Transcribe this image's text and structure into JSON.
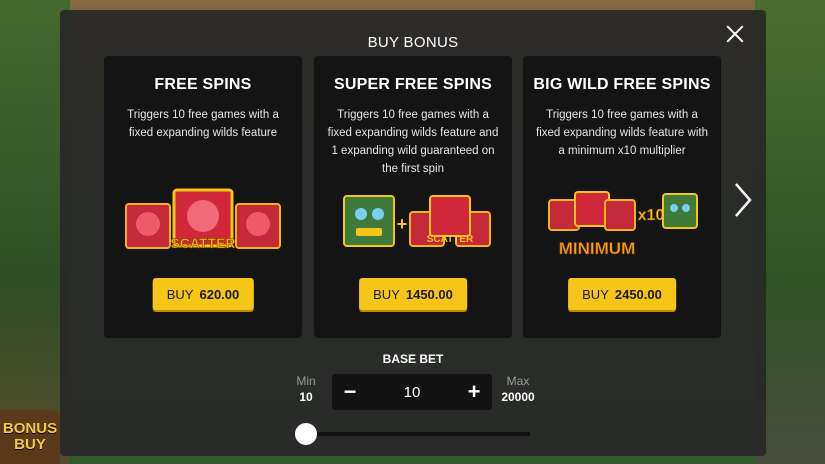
{
  "dialog": {
    "title": "BUY BONUS",
    "close_icon": "close-icon",
    "next_icon": "chevron-right-icon"
  },
  "background": {
    "badge_line1": "BONUS",
    "badge_line2": "BUY"
  },
  "cards": [
    {
      "title": "FREE SPINS",
      "description": "Triggers 10 free games with a fixed expanding wilds feature",
      "buy_label": "BUY",
      "price": "620.00",
      "art_text": "SCATTER"
    },
    {
      "title": "SUPER FREE SPINS",
      "description": "Triggers 10 free games with a fixed expanding wilds feature and 1 expanding wild guaranteed on the first spin",
      "buy_label": "BUY",
      "price": "1450.00",
      "art_text": "SCATTER"
    },
    {
      "title": "BIG WILD FREE SPINS",
      "description": "Triggers 10 free games with a fixed expanding wilds feature with a minimum x10 multiplier",
      "buy_label": "BUY",
      "price": "2450.00",
      "art_text": "MINIMUM",
      "art_mult": "x10"
    }
  ],
  "bet": {
    "label": "BASE BET",
    "min_label": "Min",
    "min_value": "10",
    "max_label": "Max",
    "max_value": "20000",
    "value": "10",
    "minus": "−",
    "plus": "+",
    "slider_level": 0
  },
  "colors": {
    "accent": "#f5c518",
    "card_bg": "#141414",
    "overlay_bg": "#282828"
  }
}
